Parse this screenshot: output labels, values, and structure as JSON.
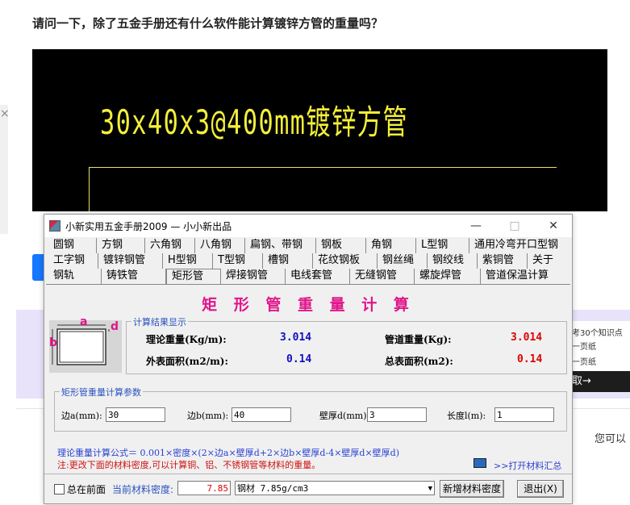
{
  "page": {
    "question_title": "请问一下，除了五金手册还有什么软件能计算镀锌方管的重量吗？",
    "cad_text": "30x40x3@400mm镀锌方管",
    "ad_line1": "考30个知识点",
    "ad_line2": "一页纸",
    "ad_line3": "一页纸",
    "ad_button": "取→",
    "side_text": "您可以",
    "close_glyph": "×"
  },
  "window": {
    "title": "小新实用五金手册2009 — 小小新出品",
    "minimize": "—",
    "maximize": "□",
    "close": "✕"
  },
  "tabs": {
    "row1": [
      "圆钢",
      "方钢",
      "六角钢",
      "八角钢",
      "扁钢、带钢",
      "钢板",
      "角钢",
      "L型钢",
      "通用冷弯开口型钢"
    ],
    "row2": [
      "工字钢",
      "镀锌钢管",
      "H型钢",
      "T型钢",
      "槽钢",
      "花纹钢板",
      "钢丝绳",
      "钢绞线",
      "紫铜管",
      "关于"
    ],
    "row3": [
      "钢轨",
      "铸铁管",
      "矩形管",
      "焊接钢管",
      "电线套管",
      "无缝钢管",
      "螺旋焊管",
      "管道保温计算"
    ],
    "active": "矩形管"
  },
  "panel": {
    "heading": "矩 形 管 重 量 计 算",
    "diagram_labels": {
      "a": "a",
      "b": "b",
      "d": "d"
    },
    "results": {
      "group_title": "计算结果显示",
      "theoretical_weight_label": "理论重量(Kg/m):",
      "theoretical_weight_value": "3.014",
      "pipe_weight_label": "管道重量(Kg):",
      "pipe_weight_value": "3.014",
      "outer_area_label": "外表面积(m2/m):",
      "outer_area_value": "0.14",
      "total_area_label": "总表面积(m2):",
      "total_area_value": "0.14"
    },
    "params": {
      "group_title": "矩形管重量计算参数",
      "side_a_label": "边a(mm):",
      "side_a_value": "30",
      "side_b_label": "边b(mm):",
      "side_b_value": "40",
      "wall_label": "壁厚d(mm):",
      "wall_value": "3",
      "length_label": "长度l(m):",
      "length_value": "1"
    },
    "formula": "理论重量计算公式＝ 0.001×密度×(2×边a×壁厚d+2×边b×壁厚d-4×壁厚d×壁厚d)",
    "note": "注:更改下面的材料密度,可以计算铜、铝、不锈钢管等材料的重量。",
    "open_summary": ">>打开材料汇总"
  },
  "bottom": {
    "always_on_top": "总在前面",
    "density_label": "当前材料密度:",
    "density_value": "7.85",
    "material_select": "钢材 7.85g/cm3",
    "add_density": "新增材料密度",
    "exit": "退出(X)"
  },
  "colors": {
    "heading": "#e0158a",
    "result_blue": "#1010c0",
    "result_red": "#e00000",
    "cad_yellow": "#f3ef3a"
  }
}
